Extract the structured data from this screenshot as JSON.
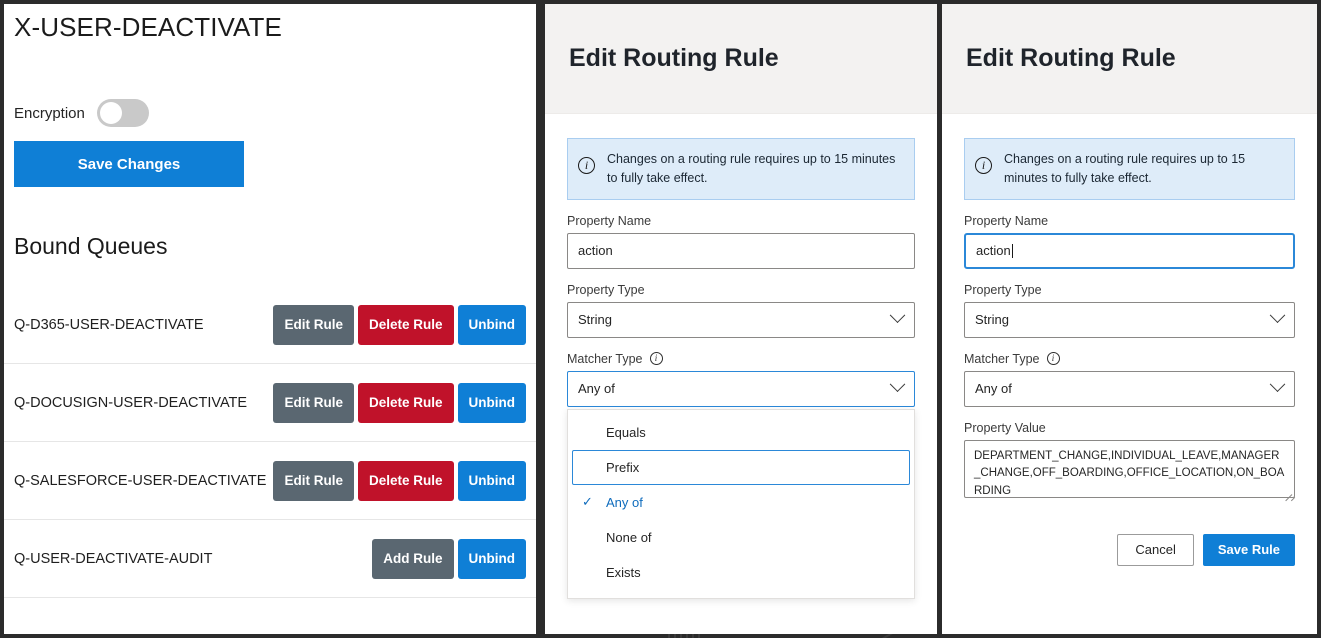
{
  "left_panel": {
    "exchange_title": "X-USER-DEACTIVATE",
    "encryption_label": "Encryption",
    "encryption_state": "off",
    "save_changes_label": "Save Changes",
    "bound_queues_title": "Bound Queues",
    "queues": [
      {
        "name": "Q-D365-USER-DEACTIVATE",
        "actions": [
          "Edit Rule",
          "Delete Rule",
          "Unbind"
        ]
      },
      {
        "name": "Q-DOCUSIGN-USER-DEACTIVATE",
        "actions": [
          "Edit Rule",
          "Delete Rule",
          "Unbind"
        ]
      },
      {
        "name": "Q-SALESFORCE-USER-DEACTIVATE",
        "actions": [
          "Edit Rule",
          "Delete Rule",
          "Unbind"
        ]
      },
      {
        "name": "Q-USER-DEACTIVATE-AUDIT",
        "actions": [
          "Add Rule",
          "Unbind"
        ]
      }
    ]
  },
  "middle_panel": {
    "header_title": "Edit Routing Rule",
    "info_banner": {
      "icon": "info-circle-icon",
      "text": "Changes on a routing rule requires up to 15 minutes to fully take effect."
    },
    "property_name": {
      "label": "Property Name",
      "value": "action",
      "placeholder": ""
    },
    "property_type": {
      "label": "Property Type",
      "value": "String"
    },
    "matcher_type": {
      "label": "Matcher Type",
      "info_icon": "info-circle-icon",
      "value": "Any of",
      "dropdown_open": true,
      "options": [
        {
          "label": "Equals",
          "selected": false,
          "focused": false
        },
        {
          "label": "Prefix",
          "selected": false,
          "focused": true
        },
        {
          "label": "Any of",
          "selected": true,
          "focused": false
        },
        {
          "label": "None of",
          "selected": false,
          "focused": false
        },
        {
          "label": "Exists",
          "selected": false,
          "focused": false
        }
      ]
    }
  },
  "right_panel": {
    "header_title": "Edit Routing Rule",
    "info_banner": {
      "icon": "info-circle-icon",
      "text": "Changes on a routing rule requires up to 15 minutes to fully take effect."
    },
    "property_name": {
      "label": "Property Name",
      "value": "action",
      "focused": true
    },
    "property_type": {
      "label": "Property Type",
      "value": "String"
    },
    "matcher_type": {
      "label": "Matcher Type",
      "info_icon": "info-circle-icon",
      "value": "Any of"
    },
    "property_value": {
      "label": "Property Value",
      "value": "DEPARTMENT_CHANGE,INDIVIDUAL_LEAVE,MANAGER_CHANGE,OFF_BOARDING,OFFICE_LOCATION,ON_BOARDING"
    },
    "cancel_label": "Cancel",
    "save_rule_label": "Save Rule"
  },
  "colors": {
    "primary_blue": "#0f7fd6",
    "accent_blue": "#0f6cbd",
    "danger_red": "#c0122a",
    "slate": "#5a6771",
    "info_bg": "#deecf9",
    "info_border": "#a9cdf0",
    "header_bg": "#f3f2f1",
    "desktop_bg": "#2b2b2b"
  }
}
